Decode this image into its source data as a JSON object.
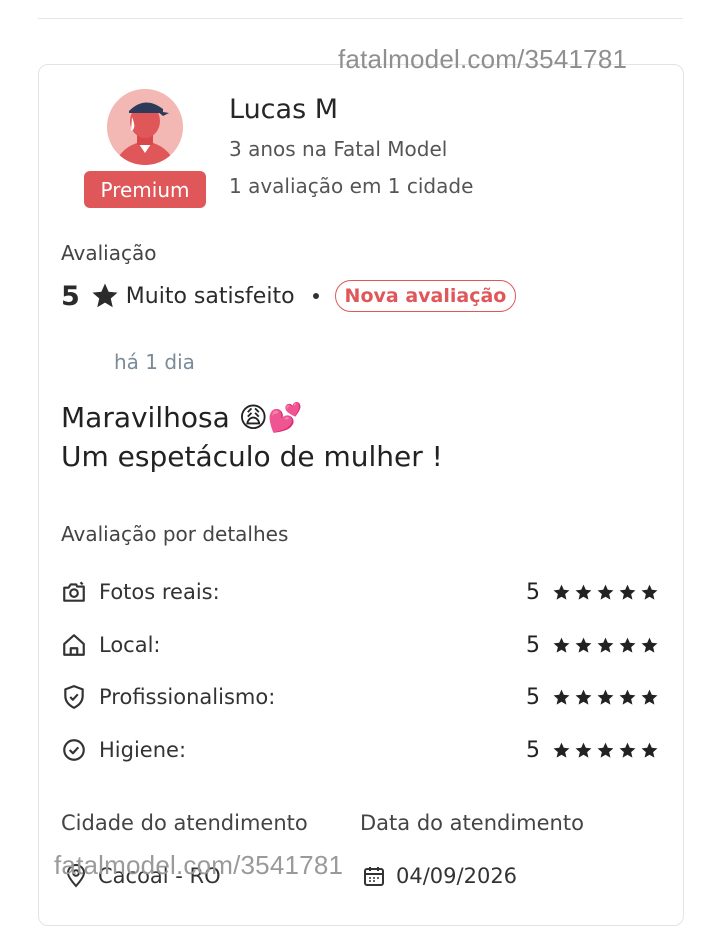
{
  "watermark": "fatalmodel.com/3541781",
  "profile": {
    "name": "Lucas M",
    "tenure": "3 anos na Fatal Model",
    "reviews_summary": "1 avaliação em 1 cidade",
    "badge": "Premium"
  },
  "rating": {
    "section_label": "Avaliação",
    "score": "5",
    "text": "Muito satisfeito",
    "new_tag": "Nova avaliação",
    "time_ago": "há 1 dia"
  },
  "review": {
    "line1": "Maravilhosa 😩💕",
    "line2": "Um espetáculo de mulher !"
  },
  "details": {
    "title": "Avaliação por detalhes",
    "items": [
      {
        "label": "Fotos reais:",
        "score": "5",
        "stars": 5,
        "icon": "camera-icon"
      },
      {
        "label": "Local:",
        "score": "5",
        "stars": 5,
        "icon": "home-icon"
      },
      {
        "label": "Profissionalismo:",
        "score": "5",
        "stars": 5,
        "icon": "shield-check-icon"
      },
      {
        "label": "Higiene:",
        "score": "5",
        "stars": 5,
        "icon": "check-circle-icon"
      }
    ]
  },
  "footer": {
    "city_label": "Cidade do atendimento",
    "city_value": "Cacoal - RO",
    "date_label": "Data do atendimento",
    "date_value": "04/09/2026"
  },
  "colors": {
    "accent": "#e0575a",
    "avatar_bg": "#f4b8b4"
  }
}
